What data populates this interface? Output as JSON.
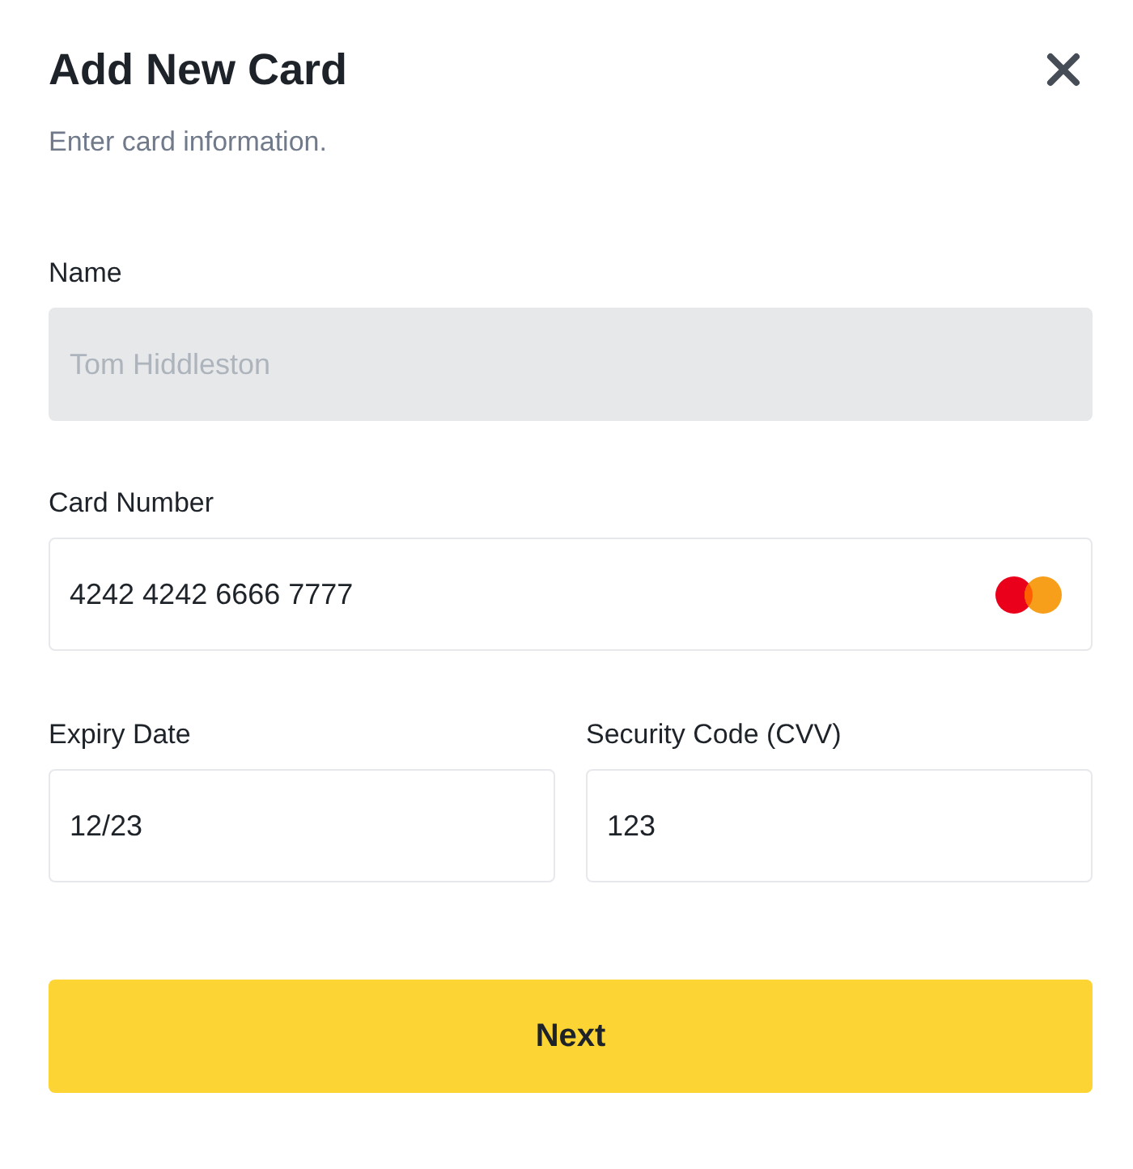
{
  "dialog": {
    "title": "Add New Card",
    "subtitle": "Enter card information."
  },
  "name_field": {
    "label": "Name",
    "value": "Tom Hiddleston",
    "disabled": true
  },
  "card_number_field": {
    "label": "Card Number",
    "value": "4242 4242 6666 7777",
    "disabled": false
  },
  "expiry_field": {
    "label": "Expiry Date",
    "value": "12/23",
    "disabled": false
  },
  "cvv_field": {
    "label": "Security Code (CVV)",
    "value": "123",
    "disabled": false
  },
  "submit_button": {
    "label": "Next"
  }
}
